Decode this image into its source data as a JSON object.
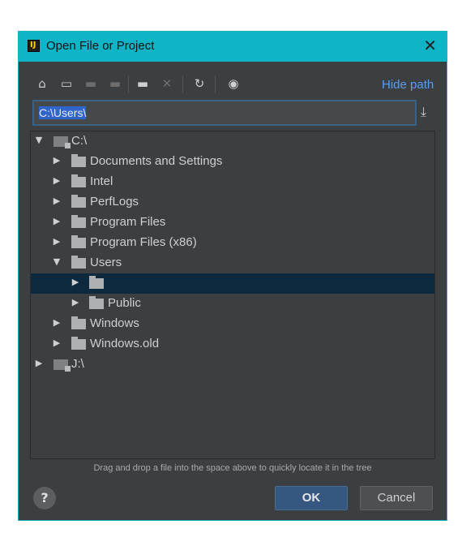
{
  "window": {
    "title": "Open File or Project",
    "title_icon_text": "IJ",
    "close_glyph": "✕"
  },
  "toolbar": {
    "buttons": [
      {
        "icon": "home-icon",
        "glyph": "⌂",
        "enabled": true
      },
      {
        "icon": "desktop-icon",
        "glyph": "▭",
        "enabled": true
      },
      {
        "icon": "project-folder-icon",
        "glyph": "▬",
        "enabled": false
      },
      {
        "icon": "module-folder-icon",
        "glyph": "▬",
        "enabled": false
      },
      {
        "icon": "new-folder-icon",
        "glyph": "▬",
        "enabled": true
      },
      {
        "icon": "delete-icon",
        "glyph": "✕",
        "enabled": false
      },
      {
        "icon": "refresh-icon",
        "glyph": "↻",
        "enabled": true
      },
      {
        "icon": "show-hidden-icon",
        "glyph": "◉",
        "enabled": true
      }
    ],
    "hide_path_label": "Hide path",
    "download_glyph": "⤓"
  },
  "path": {
    "value": "C:\\Users\\"
  },
  "tree": {
    "nodes": [
      {
        "label": "C:\\",
        "expanded": true,
        "kind": "drive"
      },
      {
        "label": "Documents and Settings",
        "expanded": false,
        "kind": "folder"
      },
      {
        "label": "Intel",
        "expanded": false,
        "kind": "folder"
      },
      {
        "label": "PerfLogs",
        "expanded": false,
        "kind": "folder"
      },
      {
        "label": "Program Files",
        "expanded": false,
        "kind": "folder"
      },
      {
        "label": "Program Files (x86)",
        "expanded": false,
        "kind": "folder"
      },
      {
        "label": "Users",
        "expanded": true,
        "kind": "folder"
      },
      {
        "label": "",
        "expanded": false,
        "kind": "folder",
        "selected": true
      },
      {
        "label": "Public",
        "expanded": false,
        "kind": "folder"
      },
      {
        "label": "Windows",
        "expanded": false,
        "kind": "folder"
      },
      {
        "label": "Windows.old",
        "expanded": false,
        "kind": "folder"
      },
      {
        "label": "J:\\",
        "expanded": false,
        "kind": "drive"
      }
    ],
    "expanded_glyph": "▼",
    "collapsed_glyph": "▶"
  },
  "hint": "Drag and drop a file into the space above to quickly locate it in the tree",
  "footer": {
    "help_glyph": "?",
    "ok_label": "OK",
    "cancel_label": "Cancel"
  }
}
